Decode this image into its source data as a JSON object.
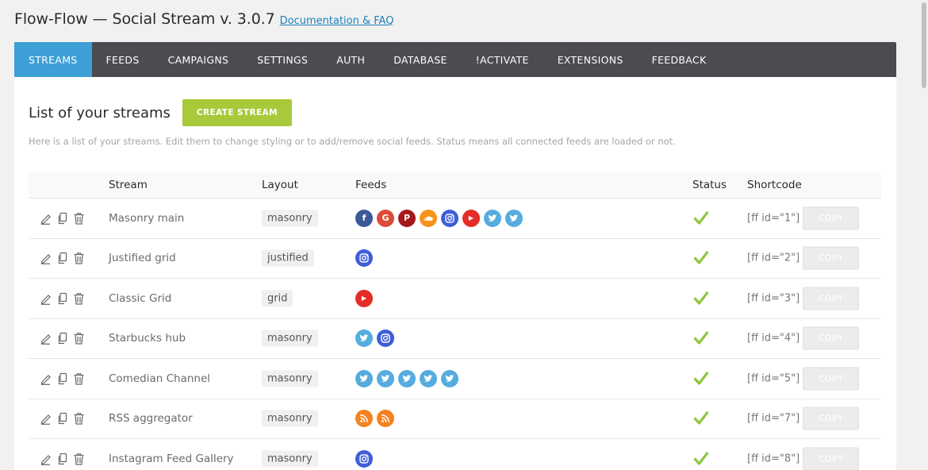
{
  "header": {
    "title": "Flow-Flow — Social Stream v. 3.0.7",
    "doc_link": "Documentation & FAQ"
  },
  "nav": {
    "tabs": [
      "STREAMS",
      "FEEDS",
      "CAMPAIGNS",
      "SETTINGS",
      "AUTH",
      "DATABASE",
      "!ACTIVATE",
      "EXTENSIONS",
      "FEEDBACK"
    ],
    "active": "STREAMS"
  },
  "panel": {
    "title": "List of your streams",
    "create_button": "CREATE STREAM",
    "description": "Here is a list of your streams. Edit them to change styling or to add/remove social feeds. Status means all connected feeds are loaded or not."
  },
  "table": {
    "headers": {
      "stream": "Stream",
      "layout": "Layout",
      "feeds": "Feeds",
      "status": "Status",
      "shortcode": "Shortcode"
    },
    "copy_label": "COPY",
    "rows": [
      {
        "name": "Masonry main",
        "layout": "masonry",
        "feeds": [
          "facebook",
          "google",
          "pinterest",
          "soundcloud",
          "instagram",
          "youtube",
          "twitter",
          "twitter"
        ],
        "status": "ok",
        "shortcode": "[ff id=\"1\"]"
      },
      {
        "name": "Justified grid",
        "layout": "justified",
        "feeds": [
          "instagram"
        ],
        "status": "ok",
        "shortcode": "[ff id=\"2\"]"
      },
      {
        "name": "Classic Grid",
        "layout": "grid",
        "feeds": [
          "youtube"
        ],
        "status": "ok",
        "shortcode": "[ff id=\"3\"]"
      },
      {
        "name": "Starbucks hub",
        "layout": "masonry",
        "feeds": [
          "twitter",
          "instagram"
        ],
        "status": "ok",
        "shortcode": "[ff id=\"4\"]"
      },
      {
        "name": "Comedian Channel",
        "layout": "masonry",
        "feeds": [
          "twitter",
          "twitter",
          "twitter",
          "twitter",
          "twitter"
        ],
        "status": "ok",
        "shortcode": "[ff id=\"5\"]"
      },
      {
        "name": "RSS aggregator",
        "layout": "masonry",
        "feeds": [
          "rss",
          "rss"
        ],
        "status": "ok",
        "shortcode": "[ff id=\"7\"]"
      },
      {
        "name": "Instagram Feed Gallery",
        "layout": "masonry",
        "feeds": [
          "instagram"
        ],
        "status": "ok",
        "shortcode": "[ff id=\"8\"]"
      }
    ]
  },
  "colors": {
    "nav_bg": "#4a4c50",
    "nav_active": "#3d9fd6",
    "create_btn": "#a8c93a",
    "status_ok": "#8dc63f",
    "facebook": "#3b5998",
    "google": "#dd4b39",
    "pinterest": "#a5171c",
    "soundcloud": "#f7921b",
    "instagram": "#3f5ed8",
    "youtube": "#e52d27",
    "twitter": "#55acdf",
    "rss": "#f58220"
  }
}
